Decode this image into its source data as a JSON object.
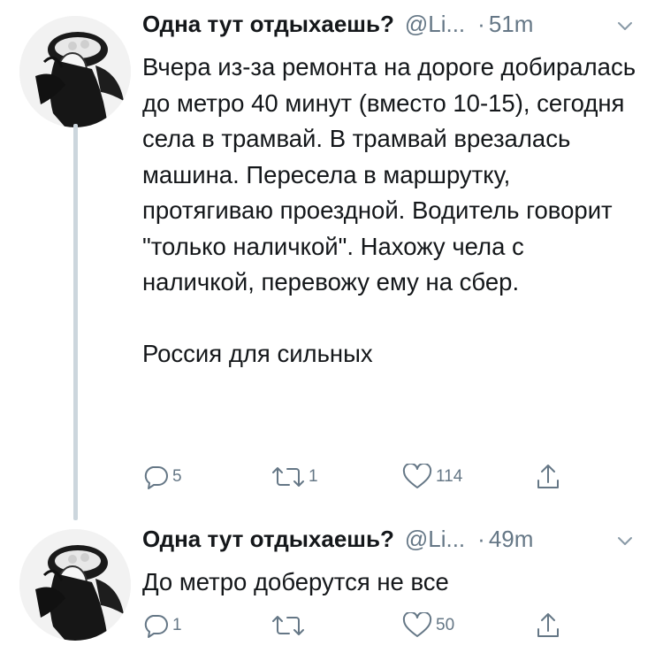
{
  "tweets": [
    {
      "display_name": "Одна тут отдыхаешь?",
      "handle": "@Li...",
      "separator": "·",
      "time": "51m",
      "paragraphs": [
        "Вчера из-за ремонта на дороге добиралась до метро 40 минут (вместо 10-15), сегодня села в трамвай. В трамвай врезалась машина. Пересела в маршрутку, протягиваю проездной. Водитель говорит \"только наличкой\". Нахожу чела с наличкой, перевожу ему на сбер.",
        "Россия для сильных"
      ],
      "replies": "5",
      "retweets": "1",
      "likes": "114"
    },
    {
      "display_name": "Одна тут отдыхаешь?",
      "handle": "@Li...",
      "separator": "·",
      "time": "49m",
      "paragraphs": [
        "До метро доберутся не все"
      ],
      "replies": "1",
      "retweets": "",
      "likes": "50"
    }
  ],
  "colors": {
    "text": "#14171a",
    "secondary": "#657786",
    "thread_line": "#ccd6dd",
    "icon": "#657786"
  },
  "icons": {
    "reply": "reply-icon",
    "retweet": "retweet-icon",
    "like": "heart-icon",
    "share": "share-icon",
    "menu": "chevron-down-icon"
  }
}
